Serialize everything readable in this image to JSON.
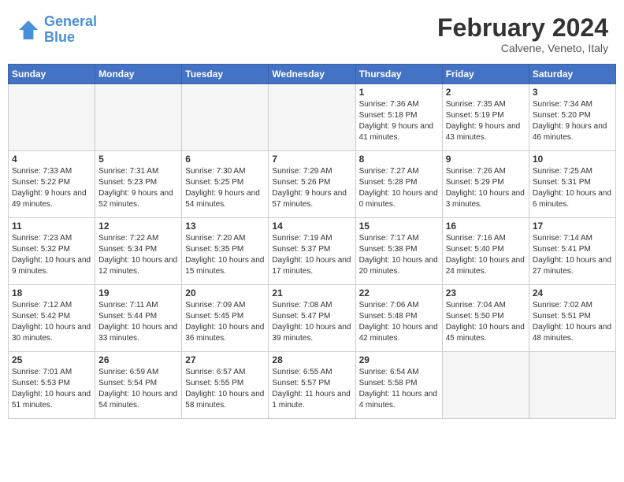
{
  "header": {
    "logo_general": "General",
    "logo_blue": "Blue",
    "month_title": "February 2024",
    "location": "Calvene, Veneto, Italy"
  },
  "days_of_week": [
    "Sunday",
    "Monday",
    "Tuesday",
    "Wednesday",
    "Thursday",
    "Friday",
    "Saturday"
  ],
  "weeks": [
    [
      {
        "day": "",
        "empty": true
      },
      {
        "day": "",
        "empty": true
      },
      {
        "day": "",
        "empty": true
      },
      {
        "day": "",
        "empty": true
      },
      {
        "day": "1",
        "sunrise": "7:36 AM",
        "sunset": "5:18 PM",
        "daylight": "9 hours and 41 minutes."
      },
      {
        "day": "2",
        "sunrise": "7:35 AM",
        "sunset": "5:19 PM",
        "daylight": "9 hours and 43 minutes."
      },
      {
        "day": "3",
        "sunrise": "7:34 AM",
        "sunset": "5:20 PM",
        "daylight": "9 hours and 46 minutes."
      }
    ],
    [
      {
        "day": "4",
        "sunrise": "7:33 AM",
        "sunset": "5:22 PM",
        "daylight": "9 hours and 49 minutes."
      },
      {
        "day": "5",
        "sunrise": "7:31 AM",
        "sunset": "5:23 PM",
        "daylight": "9 hours and 52 minutes."
      },
      {
        "day": "6",
        "sunrise": "7:30 AM",
        "sunset": "5:25 PM",
        "daylight": "9 hours and 54 minutes."
      },
      {
        "day": "7",
        "sunrise": "7:29 AM",
        "sunset": "5:26 PM",
        "daylight": "9 hours and 57 minutes."
      },
      {
        "day": "8",
        "sunrise": "7:27 AM",
        "sunset": "5:28 PM",
        "daylight": "10 hours and 0 minutes."
      },
      {
        "day": "9",
        "sunrise": "7:26 AM",
        "sunset": "5:29 PM",
        "daylight": "10 hours and 3 minutes."
      },
      {
        "day": "10",
        "sunrise": "7:25 AM",
        "sunset": "5:31 PM",
        "daylight": "10 hours and 6 minutes."
      }
    ],
    [
      {
        "day": "11",
        "sunrise": "7:23 AM",
        "sunset": "5:32 PM",
        "daylight": "10 hours and 9 minutes."
      },
      {
        "day": "12",
        "sunrise": "7:22 AM",
        "sunset": "5:34 PM",
        "daylight": "10 hours and 12 minutes."
      },
      {
        "day": "13",
        "sunrise": "7:20 AM",
        "sunset": "5:35 PM",
        "daylight": "10 hours and 15 minutes."
      },
      {
        "day": "14",
        "sunrise": "7:19 AM",
        "sunset": "5:37 PM",
        "daylight": "10 hours and 17 minutes."
      },
      {
        "day": "15",
        "sunrise": "7:17 AM",
        "sunset": "5:38 PM",
        "daylight": "10 hours and 20 minutes."
      },
      {
        "day": "16",
        "sunrise": "7:16 AM",
        "sunset": "5:40 PM",
        "daylight": "10 hours and 24 minutes."
      },
      {
        "day": "17",
        "sunrise": "7:14 AM",
        "sunset": "5:41 PM",
        "daylight": "10 hours and 27 minutes."
      }
    ],
    [
      {
        "day": "18",
        "sunrise": "7:12 AM",
        "sunset": "5:42 PM",
        "daylight": "10 hours and 30 minutes."
      },
      {
        "day": "19",
        "sunrise": "7:11 AM",
        "sunset": "5:44 PM",
        "daylight": "10 hours and 33 minutes."
      },
      {
        "day": "20",
        "sunrise": "7:09 AM",
        "sunset": "5:45 PM",
        "daylight": "10 hours and 36 minutes."
      },
      {
        "day": "21",
        "sunrise": "7:08 AM",
        "sunset": "5:47 PM",
        "daylight": "10 hours and 39 minutes."
      },
      {
        "day": "22",
        "sunrise": "7:06 AM",
        "sunset": "5:48 PM",
        "daylight": "10 hours and 42 minutes."
      },
      {
        "day": "23",
        "sunrise": "7:04 AM",
        "sunset": "5:50 PM",
        "daylight": "10 hours and 45 minutes."
      },
      {
        "day": "24",
        "sunrise": "7:02 AM",
        "sunset": "5:51 PM",
        "daylight": "10 hours and 48 minutes."
      }
    ],
    [
      {
        "day": "25",
        "sunrise": "7:01 AM",
        "sunset": "5:53 PM",
        "daylight": "10 hours and 51 minutes."
      },
      {
        "day": "26",
        "sunrise": "6:59 AM",
        "sunset": "5:54 PM",
        "daylight": "10 hours and 54 minutes."
      },
      {
        "day": "27",
        "sunrise": "6:57 AM",
        "sunset": "5:55 PM",
        "daylight": "10 hours and 58 minutes."
      },
      {
        "day": "28",
        "sunrise": "6:55 AM",
        "sunset": "5:57 PM",
        "daylight": "11 hours and 1 minute."
      },
      {
        "day": "29",
        "sunrise": "6:54 AM",
        "sunset": "5:58 PM",
        "daylight": "11 hours and 4 minutes."
      },
      {
        "day": "",
        "empty": true
      },
      {
        "day": "",
        "empty": true
      }
    ]
  ]
}
